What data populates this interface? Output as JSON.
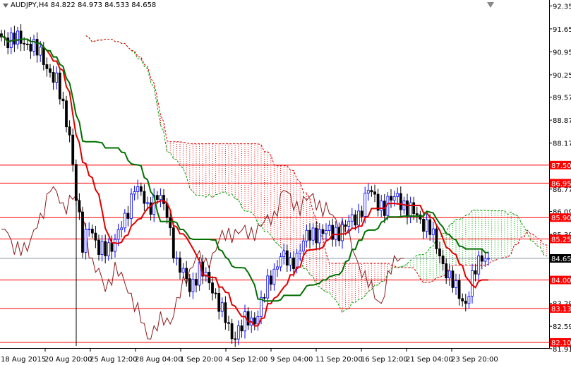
{
  "window": {
    "symbol_label": "AUDJPY,H4",
    "ohlc": "84.822 84.973 84.533 84.658"
  },
  "chart_data": {
    "type": "candlestick",
    "title": "AUDJPY,H4",
    "indicator": "Ichimoku Kinko Hyo",
    "ylim": [
      81.91,
      92.35
    ],
    "y_ticks": [
      "92.350",
      "91.650",
      "90.950",
      "90.250",
      "89.570",
      "88.870",
      "88.170",
      "86.770",
      "86.090",
      "85.390",
      "83.290",
      "82.590",
      "81.910"
    ],
    "x_ticks": [
      "18 Aug 2015",
      "20 Aug 20:00",
      "25 Aug 12:00",
      "28 Aug 04:00",
      "1 Sep 20:00",
      "4 Sep 12:00",
      "9 Sep 04:00",
      "11 Sep 20:00",
      "16 Sep 12:00",
      "21 Sep 04:00",
      "23 Sep 20:00"
    ],
    "current_price": "84.658",
    "levels": [
      "87.500",
      "86.950",
      "85.900",
      "85.250",
      "84.000",
      "83.130",
      "82.100"
    ],
    "close_path": [
      [
        0,
        91.4
      ],
      [
        9,
        91.2
      ],
      [
        13,
        90.7
      ],
      [
        17,
        90.0
      ],
      [
        21,
        88.5
      ],
      [
        23,
        86.5
      ],
      [
        25,
        85.0
      ],
      [
        27,
        85.8
      ],
      [
        30,
        84.8
      ],
      [
        35,
        85.2
      ],
      [
        38,
        85.8
      ],
      [
        41,
        86.9
      ],
      [
        45,
        86.2
      ],
      [
        48,
        86.6
      ],
      [
        51,
        86.0
      ],
      [
        54,
        84.5
      ],
      [
        58,
        83.8
      ],
      [
        61,
        84.3
      ],
      [
        65,
        83.8
      ],
      [
        68,
        83.0
      ],
      [
        71,
        82.3
      ],
      [
        75,
        82.7
      ],
      [
        78,
        82.8
      ],
      [
        82,
        83.8
      ],
      [
        86,
        84.8
      ],
      [
        89,
        84.4
      ],
      [
        93,
        85.2
      ],
      [
        98,
        85.5
      ],
      [
        102,
        85.4
      ],
      [
        107,
        85.7
      ],
      [
        110,
        86.0
      ],
      [
        113,
        86.7
      ],
      [
        116,
        86.4
      ],
      [
        118,
        86.2
      ],
      [
        122,
        86.6
      ],
      [
        125,
        86.1
      ],
      [
        128,
        86.0
      ],
      [
        132,
        85.5
      ],
      [
        135,
        84.8
      ],
      [
        138,
        84.0
      ],
      [
        141,
        83.6
      ],
      [
        143,
        83.3
      ],
      [
        146,
        84.3
      ],
      [
        148,
        84.8
      ],
      [
        150,
        84.66
      ]
    ],
    "colors": {
      "tenkan": "#e00000",
      "kijun": "#007000",
      "chikou": "#8b1a1a",
      "cloud_bear": "#e00000",
      "cloud_bull": "#00a000",
      "level": "#ff0000"
    }
  }
}
